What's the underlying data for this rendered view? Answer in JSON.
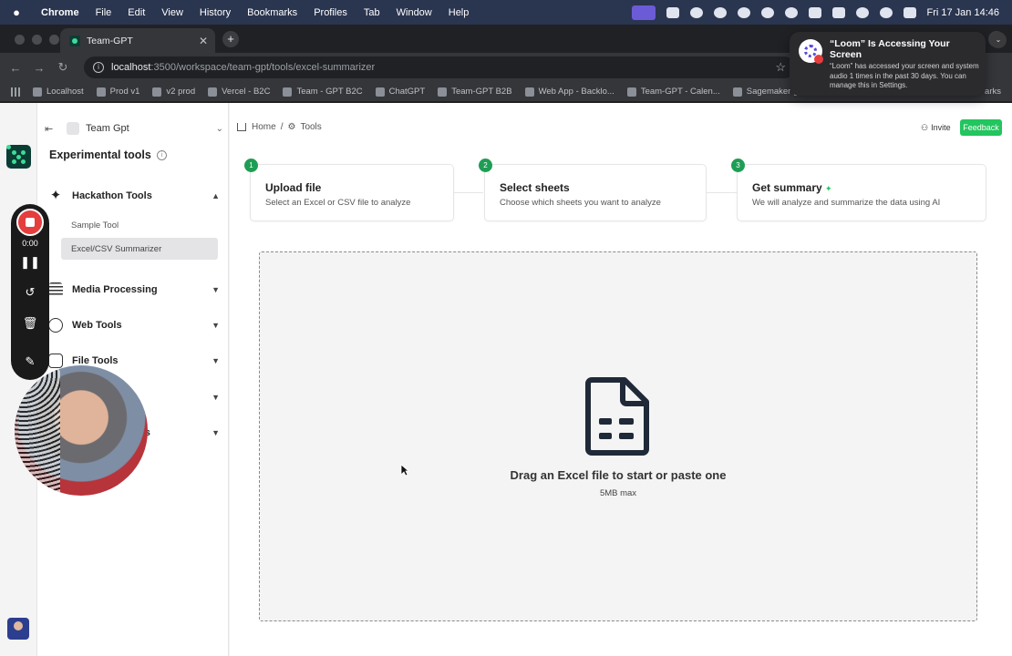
{
  "menubar": {
    "app": "Chrome",
    "items": [
      "File",
      "Edit",
      "View",
      "History",
      "Bookmarks",
      "Profiles",
      "Tab",
      "Window",
      "Help"
    ],
    "clock": "Fri 17 Jan  14:46"
  },
  "browser": {
    "tab_title": "Team-GPT",
    "url_host": "localhost",
    "url_path": ":3500/workspace/team-gpt/tools/excel-summarizer",
    "bookmarks": [
      "Localhost",
      "Prod v1",
      "v2 prod",
      "Vercel - B2C",
      "Team - GPT B2C",
      "ChatGPT",
      "Team-GPT B2B",
      "Web App - Backlo...",
      "Team-GPT - Calen...",
      "Sagemaker g..."
    ],
    "bookmarks_right": "arks"
  },
  "notification": {
    "title": "“Loom” Is Accessing Your Screen",
    "body": "“Loom” has accessed your screen and system audio 1 times in the past 30 days. You can manage this in Settings."
  },
  "loom": {
    "time": "0:00"
  },
  "sidebar": {
    "workspace": "Team Gpt",
    "title": "Experimental tools",
    "groups": [
      {
        "label": "Hackathon Tools",
        "expanded": true
      },
      {
        "label": "Media Processing"
      },
      {
        "label": "Web Tools"
      },
      {
        "label": "File Tools"
      },
      {
        "label": ""
      },
      {
        "label": "ols"
      }
    ],
    "sub_items": [
      "Sample Tool",
      "Excel/CSV Summarizer"
    ]
  },
  "header": {
    "crumb_home": "Home",
    "crumb_sep": "/",
    "crumb_tools": "Tools",
    "invite": "Invite",
    "feedback": "Feedback"
  },
  "steps": [
    {
      "num": "1",
      "title": "Upload file",
      "desc": "Select an Excel or CSV file to analyze"
    },
    {
      "num": "2",
      "title": "Select sheets",
      "desc": "Choose which sheets you want to analyze"
    },
    {
      "num": "3",
      "title": "Get summary",
      "desc": "We will analyze and summarize the data using AI"
    }
  ],
  "dropzone": {
    "title": "Drag an Excel file to start or paste one",
    "limit": "5MB max"
  },
  "colors": {
    "accent_green": "#22c55e",
    "step_badge": "#1f9d55"
  }
}
